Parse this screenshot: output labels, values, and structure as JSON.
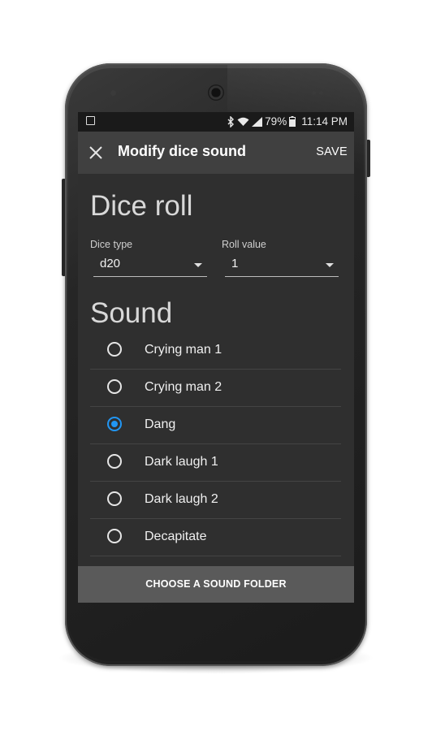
{
  "status_bar": {
    "battery": "79%",
    "time": "11:14 PM",
    "icons": [
      "image-notification-icon",
      "bluetooth-icon",
      "wifi-icon",
      "signal-icon",
      "battery-icon"
    ]
  },
  "toolbar": {
    "title": "Modify dice sound",
    "save_label": "SAVE",
    "close_icon": "close-icon"
  },
  "dice_roll": {
    "heading": "Dice roll",
    "dice_type_label": "Dice type",
    "dice_type_value": "d20",
    "roll_value_label": "Roll value",
    "roll_value_value": "1"
  },
  "sound": {
    "heading": "Sound",
    "options": [
      {
        "label": "Crying man 1",
        "selected": false
      },
      {
        "label": "Crying man 2",
        "selected": false
      },
      {
        "label": "Dang",
        "selected": true
      },
      {
        "label": "Dark laugh 1",
        "selected": false
      },
      {
        "label": "Dark laugh 2",
        "selected": false
      },
      {
        "label": "Decapitate",
        "selected": false
      }
    ]
  },
  "footer": {
    "button_label": "CHOOSE A SOUND FOLDER"
  },
  "colors": {
    "accent": "#2196f3",
    "screen_bg": "#2f2f2f",
    "toolbar_bg": "#404040",
    "footer_bg": "#5a5a5a"
  }
}
